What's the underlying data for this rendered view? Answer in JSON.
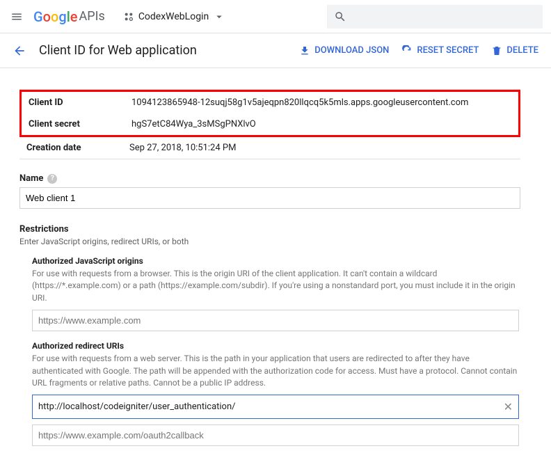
{
  "topbar": {
    "logo_apis": "APIs",
    "project_name": "CodexWebLogin"
  },
  "header": {
    "title": "Client ID for Web application",
    "download": "DOWNLOAD JSON",
    "reset": "RESET SECRET",
    "delete": "DELETE"
  },
  "info": {
    "client_id_label": "Client ID",
    "client_id_value": "1094123865948-12suqj58g1v5ajeqpn820llqcq5k5mls.apps.googleusercontent.com",
    "client_secret_label": "Client secret",
    "client_secret_value": "hgS7etC84Wya_3sMSgPNXlvO",
    "creation_label": "Creation date",
    "creation_value": "Sep 27, 2018, 10:51:24 PM"
  },
  "name_section": {
    "label": "Name",
    "value": "Web client 1"
  },
  "restrictions": {
    "heading": "Restrictions",
    "sub": "Enter JavaScript origins, redirect URIs, or both",
    "js_origins": {
      "heading": "Authorized JavaScript origins",
      "desc": "For use with requests from a browser. This is the origin URI of the client application. It can't contain a wildcard (https://*.example.com) or a path (https://example.com/subdir). If you're using a nonstandard port, you must include it in the origin URI.",
      "placeholder": "https://www.example.com"
    },
    "redirect": {
      "heading": "Authorized redirect URIs",
      "desc": "For use with requests from a web server. This is the path in your application that users are redirected to after they have authenticated with Google. The path will be appended with the authorization code for access. Must have a protocol. Cannot contain URL fragments or relative paths. Cannot be a public IP address.",
      "value": "http://localhost/codeigniter/user_authentication/",
      "placeholder": "https://www.example.com/oauth2callback"
    }
  }
}
